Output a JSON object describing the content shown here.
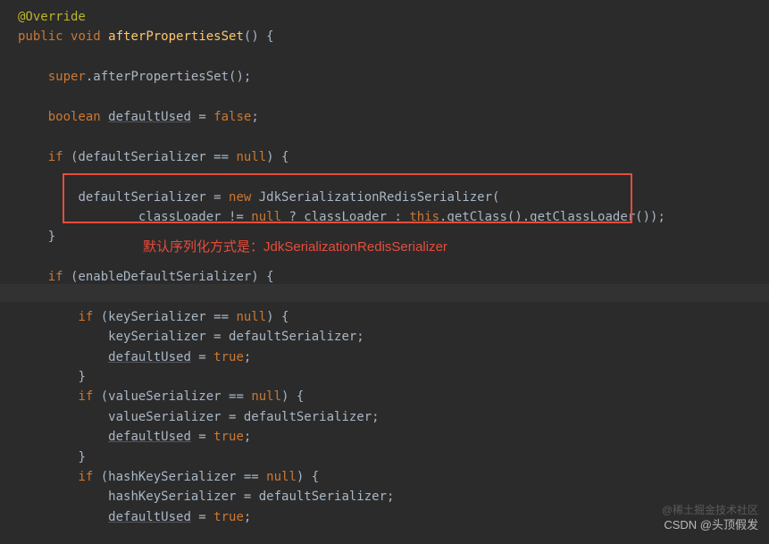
{
  "code": {
    "l1": "@Override",
    "l2_kw1": "public",
    "l2_kw2": "void",
    "l2_method": "afterPropertiesSet",
    "l2_tail": "() {",
    "l4_kw": "super",
    "l4_tail": ".afterPropertiesSet();",
    "l6_kw": "boolean",
    "l6_var": "defaultUsed",
    "l6_eq": " = ",
    "l6_val": "false",
    "l6_semi": ";",
    "l8_kw": "if",
    "l8_cond": " (defaultSerializer == ",
    "l8_null": "null",
    "l8_tail": ") {",
    "l10_lhs": "defaultSerializer = ",
    "l10_new": "new",
    "l10_cls": " JdkSerializationRedisSerializer(",
    "l11_a": "classLoader != ",
    "l11_null": "null",
    "l11_b": " ? classLoader : ",
    "l11_this": "this",
    "l11_c": ".getClass().getClassLoader());",
    "l12": "}",
    "l14_kw": "if",
    "l14_tail": " (enableDefaultSerializer) {",
    "l16_kw": "if",
    "l16_cond": " (keySerializer == ",
    "l16_null": "null",
    "l16_tail": ") {",
    "l17": "keySerializer = defaultSerializer;",
    "l18_var": "defaultUsed",
    "l18_eq": " = ",
    "l18_val": "true",
    "l18_semi": ";",
    "l19": "}",
    "l20_kw": "if",
    "l20_cond": " (valueSerializer == ",
    "l20_null": "null",
    "l20_tail": ") {",
    "l21": "valueSerializer = defaultSerializer;",
    "l22_var": "defaultUsed",
    "l22_eq": " = ",
    "l22_val": "true",
    "l22_semi": ";",
    "l23": "}",
    "l24_kw": "if",
    "l24_cond": " (hashKeySerializer == ",
    "l24_null": "null",
    "l24_tail": ") {",
    "l25": "hashKeySerializer = defaultSerializer;",
    "l26_var": "defaultUsed",
    "l26_eq": " = ",
    "l26_val": "true",
    "l26_semi": ";"
  },
  "annotation_text": "默认序列化方式是：JdkSerializationRedisSerializer",
  "watermark1": "@稀土掘金技术社区",
  "watermark2": "CSDN @头顶假发"
}
